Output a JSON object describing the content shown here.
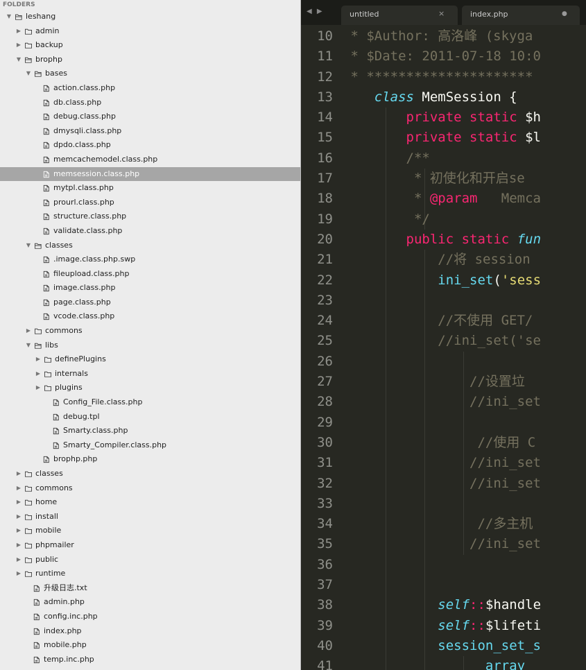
{
  "sidebar": {
    "header": "FOLDERS",
    "items": [
      {
        "label": "leshang",
        "type": "folder",
        "open": true,
        "depth": 0
      },
      {
        "label": "admin",
        "type": "folder",
        "open": false,
        "depth": 1
      },
      {
        "label": "backup",
        "type": "folder",
        "open": false,
        "depth": 1
      },
      {
        "label": "brophp",
        "type": "folder",
        "open": true,
        "depth": 1
      },
      {
        "label": "bases",
        "type": "folder",
        "open": true,
        "depth": 2
      },
      {
        "label": "action.class.php",
        "type": "file",
        "depth": 3
      },
      {
        "label": "db.class.php",
        "type": "file",
        "depth": 3
      },
      {
        "label": "debug.class.php",
        "type": "file",
        "depth": 3
      },
      {
        "label": "dmysqli.class.php",
        "type": "file",
        "depth": 3
      },
      {
        "label": "dpdo.class.php",
        "type": "file",
        "depth": 3
      },
      {
        "label": "memcachemodel.class.php",
        "type": "file",
        "depth": 3
      },
      {
        "label": "memsession.class.php",
        "type": "file",
        "depth": 3,
        "selected": true
      },
      {
        "label": "mytpl.class.php",
        "type": "file",
        "depth": 3
      },
      {
        "label": "prourl.class.php",
        "type": "file",
        "depth": 3
      },
      {
        "label": "structure.class.php",
        "type": "file",
        "depth": 3
      },
      {
        "label": "validate.class.php",
        "type": "file",
        "depth": 3
      },
      {
        "label": "classes",
        "type": "folder",
        "open": true,
        "depth": 2
      },
      {
        "label": ".image.class.php.swp",
        "type": "file",
        "depth": 3
      },
      {
        "label": "fileupload.class.php",
        "type": "file",
        "depth": 3
      },
      {
        "label": "image.class.php",
        "type": "file",
        "depth": 3
      },
      {
        "label": "page.class.php",
        "type": "file",
        "depth": 3
      },
      {
        "label": "vcode.class.php",
        "type": "file",
        "depth": 3
      },
      {
        "label": "commons",
        "type": "folder",
        "open": false,
        "depth": 2
      },
      {
        "label": "libs",
        "type": "folder",
        "open": true,
        "depth": 2
      },
      {
        "label": "definePlugins",
        "type": "folder",
        "open": false,
        "depth": 3
      },
      {
        "label": "internals",
        "type": "folder",
        "open": false,
        "depth": 3
      },
      {
        "label": "plugins",
        "type": "folder",
        "open": false,
        "depth": 3
      },
      {
        "label": "Config_File.class.php",
        "type": "file",
        "depth": 4
      },
      {
        "label": "debug.tpl",
        "type": "file",
        "depth": 4
      },
      {
        "label": "Smarty.class.php",
        "type": "file",
        "depth": 4
      },
      {
        "label": "Smarty_Compiler.class.php",
        "type": "file",
        "depth": 4
      },
      {
        "label": "brophp.php",
        "type": "file",
        "depth": 3
      },
      {
        "label": "classes",
        "type": "folder",
        "open": false,
        "depth": 1
      },
      {
        "label": "commons",
        "type": "folder",
        "open": false,
        "depth": 1
      },
      {
        "label": "home",
        "type": "folder",
        "open": false,
        "depth": 1
      },
      {
        "label": "install",
        "type": "folder",
        "open": false,
        "depth": 1
      },
      {
        "label": "mobile",
        "type": "folder",
        "open": false,
        "depth": 1
      },
      {
        "label": "phpmailer",
        "type": "folder",
        "open": false,
        "depth": 1
      },
      {
        "label": "public",
        "type": "folder",
        "open": false,
        "depth": 1
      },
      {
        "label": "runtime",
        "type": "folder",
        "open": false,
        "depth": 1
      },
      {
        "label": "升级日志.txt",
        "type": "file",
        "depth": 2
      },
      {
        "label": "admin.php",
        "type": "file",
        "depth": 2
      },
      {
        "label": "config.inc.php",
        "type": "file",
        "depth": 2
      },
      {
        "label": "index.php",
        "type": "file",
        "depth": 2
      },
      {
        "label": "mobile.php",
        "type": "file",
        "depth": 2
      },
      {
        "label": "temp.inc.php",
        "type": "file",
        "depth": 2
      }
    ]
  },
  "tabs": {
    "nav": "◀ ▶",
    "items": [
      {
        "label": "untitled",
        "close": "×",
        "active": false
      },
      {
        "label": "index.php",
        "close": "●",
        "active": false
      }
    ]
  },
  "code": {
    "lines": [
      {
        "n": "10",
        "guides": [],
        "tokens": [
          [
            "c-comment",
            " * $Author: 高洛峰 (skyga"
          ]
        ]
      },
      {
        "n": "11",
        "guides": [],
        "tokens": [
          [
            "c-comment",
            " * $Date: 2011-07-18 10:0"
          ]
        ]
      },
      {
        "n": "12",
        "guides": [],
        "tokens": [
          [
            "c-comment",
            " * *********************"
          ]
        ]
      },
      {
        "n": "13",
        "guides": [],
        "tokens": [
          [
            "c-plain",
            "    "
          ],
          [
            "c-storage",
            "class"
          ],
          [
            "c-plain",
            " MemSession {"
          ]
        ]
      },
      {
        "n": "14",
        "guides": [
          1
        ],
        "tokens": [
          [
            "c-plain",
            "        "
          ],
          [
            "c-keyword",
            "private static"
          ],
          [
            "c-plain",
            " $h"
          ]
        ]
      },
      {
        "n": "15",
        "guides": [
          1
        ],
        "tokens": [
          [
            "c-plain",
            "        "
          ],
          [
            "c-keyword",
            "private static"
          ],
          [
            "c-plain",
            " $l"
          ]
        ]
      },
      {
        "n": "16",
        "guides": [
          1
        ],
        "tokens": [
          [
            "c-plain",
            "        "
          ],
          [
            "c-comment",
            "/**"
          ]
        ]
      },
      {
        "n": "17",
        "guides": [
          1,
          2
        ],
        "tokens": [
          [
            "c-plain",
            "         "
          ],
          [
            "c-comment",
            "* 初使化和开启se"
          ]
        ]
      },
      {
        "n": "18",
        "guides": [
          1,
          2
        ],
        "tokens": [
          [
            "c-plain",
            "         "
          ],
          [
            "c-comment",
            "* "
          ],
          [
            "c-doc",
            "@param"
          ],
          [
            "c-comment",
            "   Memca"
          ]
        ]
      },
      {
        "n": "19",
        "guides": [
          1,
          2
        ],
        "tokens": [
          [
            "c-plain",
            "         "
          ],
          [
            "c-comment",
            "*/"
          ]
        ]
      },
      {
        "n": "20",
        "guides": [
          1
        ],
        "tokens": [
          [
            "c-plain",
            "        "
          ],
          [
            "c-keyword",
            "public static"
          ],
          [
            "c-plain",
            " "
          ],
          [
            "c-storage",
            "fun"
          ]
        ]
      },
      {
        "n": "21",
        "guides": [
          1,
          2
        ],
        "tokens": [
          [
            "c-plain",
            "            "
          ],
          [
            "c-comment",
            "//将 session"
          ]
        ]
      },
      {
        "n": "22",
        "guides": [
          1,
          2
        ],
        "tokens": [
          [
            "c-plain",
            "            "
          ],
          [
            "c-func",
            "ini_set"
          ],
          [
            "c-plain",
            "("
          ],
          [
            "c-string",
            "'sess"
          ]
        ]
      },
      {
        "n": "23",
        "guides": [
          1,
          2
        ],
        "tokens": [
          [
            "c-plain",
            ""
          ]
        ]
      },
      {
        "n": "24",
        "guides": [
          1,
          2
        ],
        "tokens": [
          [
            "c-plain",
            "            "
          ],
          [
            "c-comment",
            "//不使用 GET/"
          ]
        ]
      },
      {
        "n": "25",
        "guides": [
          1,
          2
        ],
        "tokens": [
          [
            "c-plain",
            "            "
          ],
          [
            "c-comment",
            "//ini_set('se"
          ]
        ]
      },
      {
        "n": "26",
        "guides": [
          1,
          2,
          3
        ],
        "tokens": [
          [
            "c-plain",
            ""
          ]
        ]
      },
      {
        "n": "27",
        "guides": [
          1,
          2,
          3
        ],
        "tokens": [
          [
            "c-plain",
            "                "
          ],
          [
            "c-comment",
            "//设置垃"
          ]
        ]
      },
      {
        "n": "28",
        "guides": [
          1,
          2,
          3
        ],
        "tokens": [
          [
            "c-plain",
            "                "
          ],
          [
            "c-comment",
            "//ini_set"
          ]
        ]
      },
      {
        "n": "29",
        "guides": [
          1,
          2,
          3
        ],
        "tokens": [
          [
            "c-plain",
            ""
          ]
        ]
      },
      {
        "n": "30",
        "guides": [
          1,
          2,
          3
        ],
        "tokens": [
          [
            "c-plain",
            "                 "
          ],
          [
            "c-comment",
            "//使用 C"
          ]
        ]
      },
      {
        "n": "31",
        "guides": [
          1,
          2,
          3
        ],
        "tokens": [
          [
            "c-plain",
            "                "
          ],
          [
            "c-comment",
            "//ini_set"
          ]
        ]
      },
      {
        "n": "32",
        "guides": [
          1,
          2,
          3
        ],
        "tokens": [
          [
            "c-plain",
            "                "
          ],
          [
            "c-comment",
            "//ini_set"
          ]
        ]
      },
      {
        "n": "33",
        "guides": [
          1,
          2,
          3
        ],
        "tokens": [
          [
            "c-plain",
            ""
          ]
        ]
      },
      {
        "n": "34",
        "guides": [
          1,
          2,
          3
        ],
        "tokens": [
          [
            "c-plain",
            "                 "
          ],
          [
            "c-comment",
            "//多主机"
          ]
        ]
      },
      {
        "n": "35",
        "guides": [
          1,
          2,
          3
        ],
        "tokens": [
          [
            "c-plain",
            "                "
          ],
          [
            "c-comment",
            "//ini_set"
          ]
        ]
      },
      {
        "n": "36",
        "guides": [
          1,
          2
        ],
        "tokens": [
          [
            "c-plain",
            ""
          ]
        ]
      },
      {
        "n": "37",
        "guides": [
          1,
          2
        ],
        "tokens": [
          [
            "c-plain",
            ""
          ]
        ]
      },
      {
        "n": "38",
        "guides": [
          1,
          2
        ],
        "tokens": [
          [
            "c-plain",
            "            "
          ],
          [
            "c-storage",
            "self"
          ],
          [
            "c-op",
            "::"
          ],
          [
            "c-plain",
            "$handle"
          ]
        ]
      },
      {
        "n": "39",
        "guides": [
          1,
          2
        ],
        "tokens": [
          [
            "c-plain",
            "            "
          ],
          [
            "c-storage",
            "self"
          ],
          [
            "c-op",
            "::"
          ],
          [
            "c-plain",
            "$lifeti"
          ]
        ]
      },
      {
        "n": "40",
        "guides": [
          1,
          2
        ],
        "tokens": [
          [
            "c-plain",
            "            "
          ],
          [
            "c-func",
            "session_set_s"
          ]
        ]
      },
      {
        "n": "41",
        "guides": [
          1,
          2,
          3
        ],
        "tokens": [
          [
            "c-plain",
            "                  "
          ],
          [
            "c-func",
            "array"
          ]
        ]
      }
    ]
  }
}
